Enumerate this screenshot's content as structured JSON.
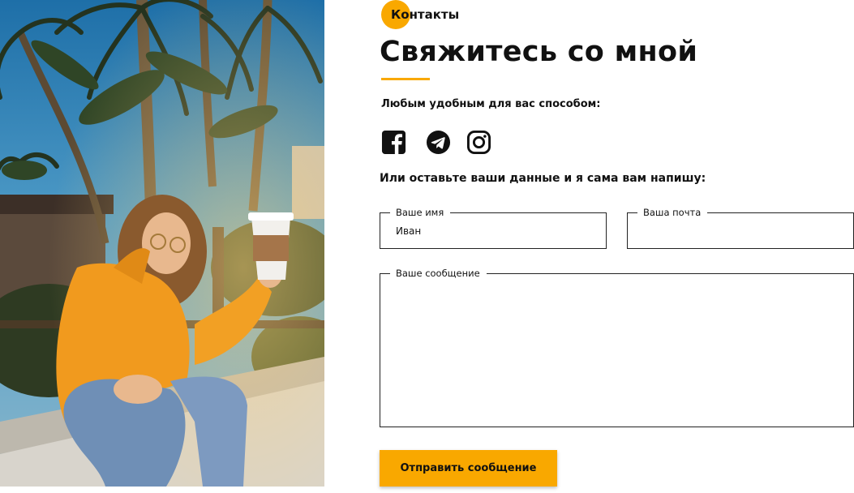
{
  "photo": {
    "alt": "girl-with-coffee-cup-photo"
  },
  "section_tag": "Контакты",
  "title": "Свяжитесь со мной",
  "subtitle_social": "Любым удобным для вас способом:",
  "social_icons": [
    "facebook-icon",
    "telegram-icon",
    "instagram-icon"
  ],
  "subtitle_form": "Или оставьте ваши данные и я сама вам напишу:",
  "form": {
    "name_label": "Ваше имя",
    "name_value": "Иван",
    "email_label": "Ваша почта",
    "email_value": "",
    "message_label": "Ваше сообщение",
    "message_value": "",
    "submit_label": "Отправить сообщение"
  },
  "colors": {
    "accent": "#f9a800",
    "text": "#111111",
    "background": "#ffffff"
  }
}
